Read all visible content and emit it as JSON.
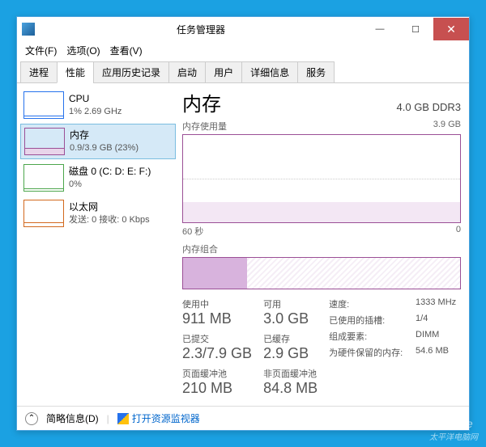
{
  "window": {
    "title": "任务管理器",
    "minimize": "—",
    "maximize": "☐",
    "close": "✕"
  },
  "menu": [
    "文件(F)",
    "选项(O)",
    "查看(V)"
  ],
  "tabs": [
    "进程",
    "性能",
    "应用历史记录",
    "启动",
    "用户",
    "详细信息",
    "服务"
  ],
  "sidebar": [
    {
      "name": "CPU",
      "sub": "1%  2.69 GHz"
    },
    {
      "name": "内存",
      "sub": "0.9/3.9 GB (23%)"
    },
    {
      "name": "磁盘 0 (C: D: E: F:)",
      "sub": "0%"
    },
    {
      "name": "以太网",
      "sub": "发送: 0  接收: 0 Kbps"
    }
  ],
  "main": {
    "title": "内存",
    "right": "4.0 GB DDR3",
    "usage_label": "内存使用量",
    "usage_max": "3.9 GB",
    "axis_left": "60 秒",
    "axis_right": "0",
    "comp_label": "内存组合",
    "stats": {
      "inuse_label": "使用中",
      "inuse": "911 MB",
      "avail_label": "可用",
      "avail": "3.0 GB",
      "committed_label": "已提交",
      "committed": "2.3/7.9 GB",
      "cached_label": "已缓存",
      "cached": "2.9 GB",
      "paged_label": "页面缓冲池",
      "paged": "210 MB",
      "nonpaged_label": "非页面缓冲池",
      "nonpaged": "84.8 MB"
    },
    "stats2": {
      "speed_label": "速度:",
      "speed": "1333 MHz",
      "slots_label": "已使用的插槽:",
      "slots": "1/4",
      "form_label": "组成要素:",
      "form": "DIMM",
      "hw_label": "为硬件保留的内存:",
      "hw": "54.6 MB"
    }
  },
  "footer": {
    "simple": "简略信息(D)",
    "monitor": "打开资源监视器"
  },
  "watermark": {
    "en": "Pconline",
    "cn": "太平洋电脑网"
  },
  "chart_data": {
    "type": "area",
    "title": "内存使用量",
    "x": [
      60,
      0
    ],
    "xlabel": "秒",
    "ylim": [
      0,
      3.9
    ],
    "ylabel": "GB",
    "values": [
      0.9,
      0.9,
      0.9,
      0.9,
      0.9,
      0.9,
      0.9,
      0.9,
      0.9,
      0.9
    ],
    "usage_fraction": 0.23,
    "total_gb": 3.9,
    "used_gb": 0.9
  }
}
